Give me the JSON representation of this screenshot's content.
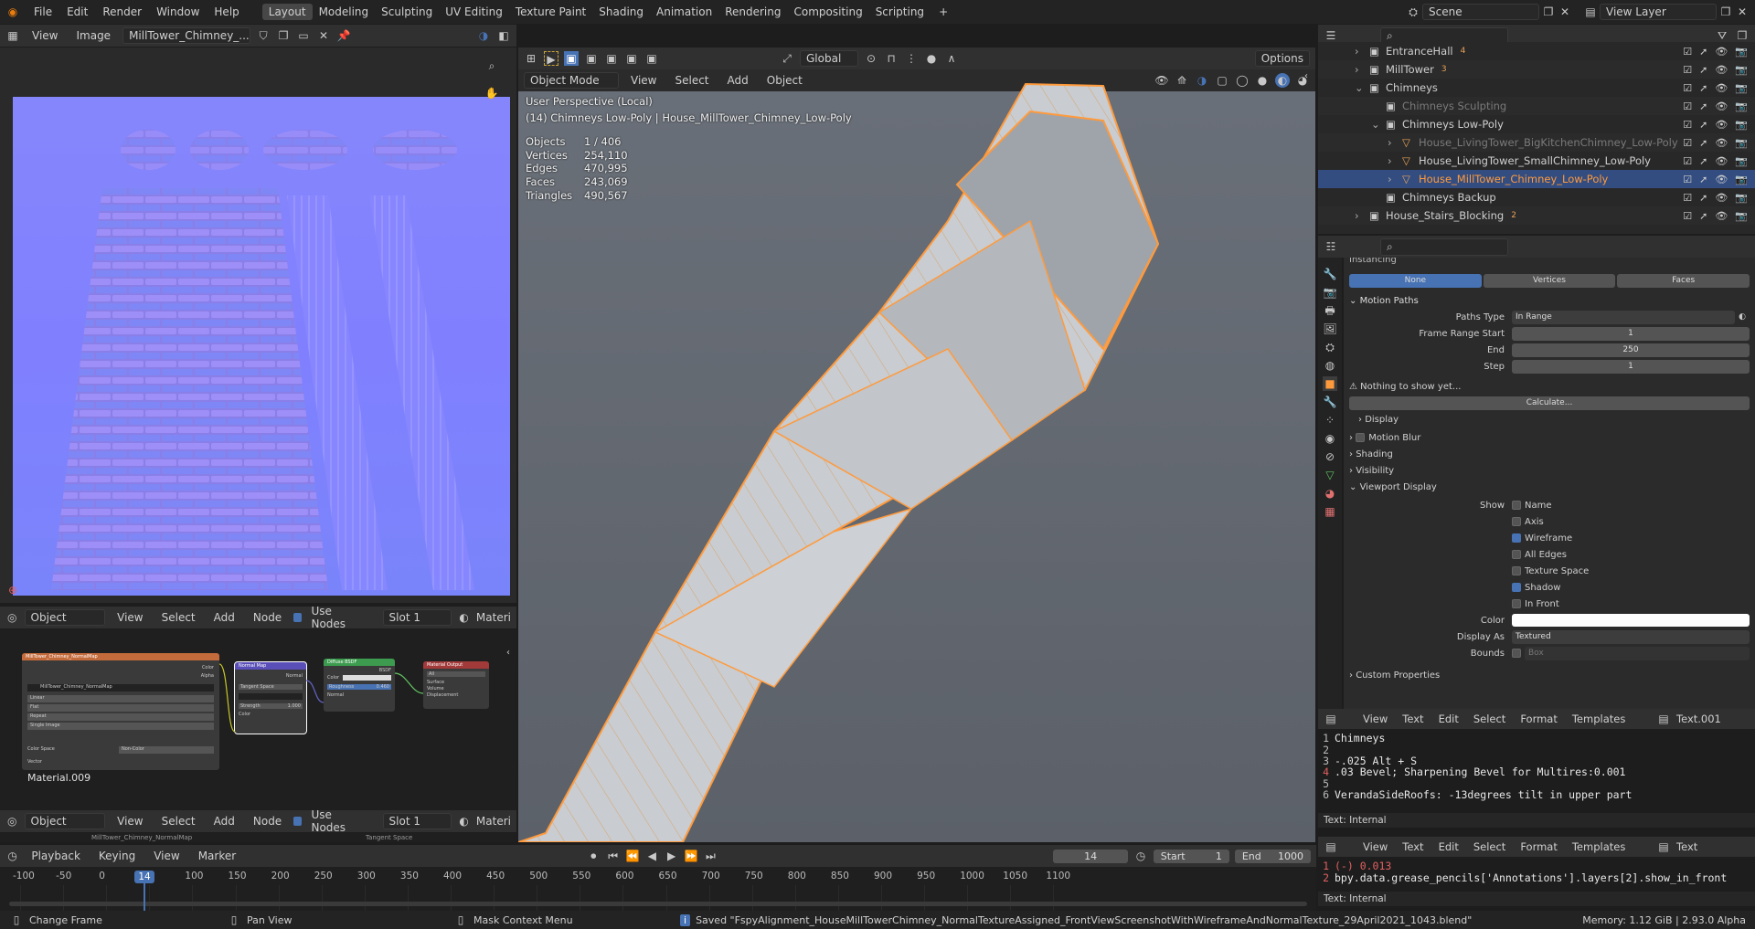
{
  "menus": [
    "File",
    "Edit",
    "Render",
    "Window",
    "Help"
  ],
  "workspaces": [
    "Layout",
    "Modeling",
    "Sculpting",
    "UV Editing",
    "Texture Paint",
    "Shading",
    "Animation",
    "Rendering",
    "Compositing",
    "Scripting"
  ],
  "active_workspace": "Layout",
  "scene": "Scene",
  "view_layer": "View Layer",
  "image_editor": {
    "view": "View",
    "image": "Image",
    "image_name": "MillTower_Chimney_..."
  },
  "viewport": {
    "mode": "Object Mode",
    "view": "View",
    "select": "Select",
    "add": "Add",
    "object": "Object",
    "orientation": "Global",
    "options": "Options",
    "title": "User Perspective (Local)",
    "subtitle": "(14) Chimneys Low-Poly | House_MillTower_Chimney_Low-Poly",
    "stats": [
      {
        "label": "Objects",
        "value": "1 / 406"
      },
      {
        "label": "Vertices",
        "value": "254,110"
      },
      {
        "label": "Edges",
        "value": "470,995"
      },
      {
        "label": "Faces",
        "value": "243,069"
      },
      {
        "label": "Triangles",
        "value": "490,567"
      }
    ]
  },
  "outliner": {
    "items": [
      {
        "indent": 0,
        "arrow": "›",
        "name": "EntranceHall",
        "icon": "collection",
        "badge": "4",
        "dim": false,
        "sel": false
      },
      {
        "indent": 0,
        "arrow": "›",
        "name": "MillTower",
        "icon": "collection",
        "badge": "3",
        "dim": false,
        "sel": false
      },
      {
        "indent": 0,
        "arrow": "⌄",
        "name": "Chimneys",
        "icon": "collection",
        "badge": "",
        "dim": false,
        "sel": false
      },
      {
        "indent": 1,
        "arrow": "",
        "name": "Chimneys Sculpting",
        "icon": "collection",
        "badge": "",
        "dim": true,
        "sel": false
      },
      {
        "indent": 1,
        "arrow": "⌄",
        "name": "Chimneys Low-Poly",
        "icon": "collection",
        "badge": "",
        "dim": false,
        "sel": false
      },
      {
        "indent": 2,
        "arrow": "›",
        "name": "House_LivingTower_BigKitchenChimney_Low-Poly",
        "icon": "mesh",
        "badge": "",
        "dim": true,
        "sel": false
      },
      {
        "indent": 2,
        "arrow": "›",
        "name": "House_LivingTower_SmallChimney_Low-Poly",
        "icon": "mesh",
        "badge": "",
        "dim": false,
        "sel": false
      },
      {
        "indent": 2,
        "arrow": "›",
        "name": "House_MillTower_Chimney_Low-Poly",
        "icon": "mesh",
        "badge": "",
        "dim": false,
        "sel": true
      },
      {
        "indent": 1,
        "arrow": "",
        "name": "Chimneys Backup",
        "icon": "collection",
        "badge": "",
        "dim": false,
        "sel": false
      },
      {
        "indent": 0,
        "arrow": "›",
        "name": "House_Stairs_Blocking",
        "icon": "collection",
        "badge": "2",
        "dim": false,
        "sel": false
      }
    ]
  },
  "properties": {
    "instancing_title": "Instancing",
    "instancing": [
      "None",
      "Vertices",
      "Faces"
    ],
    "motion_paths": "Motion Paths",
    "paths_type_label": "Paths Type",
    "paths_type": "In Range",
    "frame_start_label": "Frame Range Start",
    "frame_start": "1",
    "end_label": "End",
    "end": "250",
    "step_label": "Step",
    "step": "1",
    "nothing": "Nothing to show yet...",
    "calculate": "Calculate...",
    "display": "Display",
    "motion_blur": "Motion Blur",
    "shading": "Shading",
    "visibility": "Visibility",
    "viewport_display": "Viewport Display",
    "show_label": "Show",
    "show": [
      {
        "label": "Name",
        "on": false
      },
      {
        "label": "Axis",
        "on": false
      },
      {
        "label": "Wireframe",
        "on": true
      },
      {
        "label": "All Edges",
        "on": false
      },
      {
        "label": "Texture Space",
        "on": false
      },
      {
        "label": "Shadow",
        "on": true
      },
      {
        "label": "In Front",
        "on": false
      }
    ],
    "color_label": "Color",
    "display_as_label": "Display As",
    "display_as": "Textured",
    "bounds_label": "Bounds",
    "bounds": "Box",
    "custom_props": "Custom Properties"
  },
  "text_editor_1": {
    "menus": [
      "View",
      "Text",
      "Edit",
      "Select",
      "Format",
      "Templates"
    ],
    "name": "Text.001",
    "lines": [
      {
        "n": "1",
        "t": "Chimneys"
      },
      {
        "n": "2",
        "t": ""
      },
      {
        "n": "3",
        "t": "-.025 Alt + S"
      },
      {
        "n": "4",
        "t": ".03 Bevel; Sharpening Bevel for Multires:0.001"
      },
      {
        "n": "5",
        "t": ""
      },
      {
        "n": "6",
        "t": "VerandaSideRoofs: -13degrees tilt in upper part"
      }
    ],
    "footer": "Text: Internal"
  },
  "text_editor_2": {
    "menus": [
      "View",
      "Text",
      "Edit",
      "Select",
      "Format",
      "Templates"
    ],
    "name": "Text",
    "lines": [
      {
        "n": "1",
        "t": "(-) 0.013"
      },
      {
        "n": "2",
        "t": "bpy.data.grease_pencils['Annotations'].layers[2].show_in_front"
      }
    ],
    "footer": "Text: Internal"
  },
  "node_editor": {
    "object": "Object",
    "view": "View",
    "select": "Select",
    "add": "Add",
    "node": "Node",
    "use_nodes": "Use Nodes",
    "slot": "Slot 1",
    "material": "Materi",
    "material_name": "Material.009",
    "nodes": {
      "image": "MillTower_Chimney_NormalMap",
      "image_file": "MillTower_Chimney_NormalMap",
      "image_opts": [
        "Linear",
        "Flat",
        "Repeat",
        "Single Image"
      ],
      "color_space_label": "Color Space",
      "color_space": "Non-Color",
      "vector": "Vector",
      "out_color": "Color",
      "out_alpha": "Alpha",
      "normal_map": "Normal Map",
      "normal_out": "Normal",
      "tangent": "Tangent Space",
      "strength": "Strength",
      "strength_val": "1.000",
      "nm_color": "Color",
      "bsdf": "Diffuse BSDF",
      "bsdf_out": "BSDF",
      "bsdf_color": "Color",
      "roughness": "Roughness",
      "roughness_val": "0.460",
      "bsdf_normal": "Normal",
      "output": "Material Output",
      "output_target": "All",
      "surface": "Surface",
      "volume": "Volume",
      "displacement": "Displacement"
    }
  },
  "node_editor_2": {
    "object": "Object",
    "view": "View",
    "select": "Select",
    "add": "Add",
    "node": "Node",
    "use_nodes": "Use Nodes",
    "slot": "Slot 1",
    "material": "Materi",
    "peek1": "MillTower_Chimney_NormalMap",
    "peek2": "Tangent Space"
  },
  "timeline": {
    "playback": "Playback",
    "keying": "Keying",
    "view": "View",
    "marker": "Marker",
    "current_frame": "14",
    "start_label": "Start",
    "start": "1",
    "end_label": "End",
    "end": "1000",
    "ticks": [
      "-100",
      "-50",
      "0",
      "50",
      "100",
      "150",
      "200",
      "250",
      "300",
      "350",
      "400",
      "450",
      "500",
      "550",
      "600",
      "650",
      "700",
      "750",
      "800",
      "850",
      "900",
      "950",
      "1000",
      "1050",
      "1100"
    ]
  },
  "status": {
    "change_frame": "Change Frame",
    "pan_view": "Pan View",
    "context_menu": "Mask Context Menu",
    "saved": "Saved \"FspyAlignment_HouseMillTowerChimney_NormalTextureAssigned_FrontViewScreenshotWithWireframeAndNormalTexture_29April2021_1043.blend\"",
    "memory": "Memory: 1.12 GiB | 2.93.0 Alpha"
  },
  "colors": {
    "accent": "#4772b3",
    "selected_outline": "#ff9a3c",
    "normal_map": "#8080ff"
  }
}
